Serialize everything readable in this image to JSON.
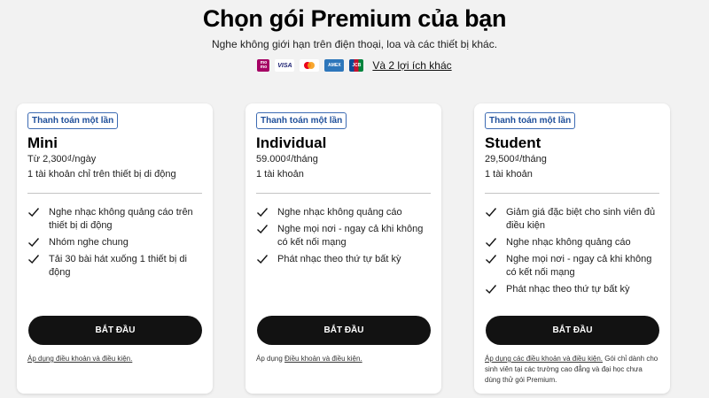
{
  "header": {
    "title": "Chọn gói Premium của bạn",
    "subtitle": "Nghe không giới hạn trên điện thoại, loa và các thiết bị khác.",
    "payment_methods": [
      {
        "icon": "momo-icon",
        "label": "mo mo"
      },
      {
        "icon": "visa-icon",
        "label": "VISA"
      },
      {
        "icon": "mastercard-icon",
        "label": ""
      },
      {
        "icon": "amex-icon",
        "label": "AMEX"
      },
      {
        "icon": "jcb-icon",
        "label": "JCB"
      }
    ],
    "more_benefits": "Và 2 lợi ích khác"
  },
  "plans": [
    {
      "badge": "Thanh toán một lần",
      "name": "Mini",
      "price": "Từ 2,300₫/ngày",
      "accounts": "1 tài khoản chỉ trên thiết bị di động",
      "features": [
        "Nghe nhạc không quảng cáo trên thiết bị di động",
        "Nhóm nghe chung",
        "Tải 30 bài hát xuống 1 thiết bị di động"
      ],
      "cta": "BẮT ĐẦU",
      "terms_prefix": "",
      "terms_link": "Áp dụng điều khoản và điều kiện.",
      "terms_suffix": ""
    },
    {
      "badge": "Thanh toán một lần",
      "name": "Individual",
      "price": "59.000₫/tháng",
      "accounts": "1 tài khoản",
      "features": [
        "Nghe nhạc không quảng cáo",
        "Nghe mọi nơi - ngay cả khi không có kết nối mạng",
        "Phát nhạc theo thứ tự bất kỳ"
      ],
      "cta": "BẮT ĐẦU",
      "terms_prefix": "Áp dụng ",
      "terms_link": "Điều khoản và điều kiện.",
      "terms_suffix": ""
    },
    {
      "badge": "Thanh toán một lần",
      "name": "Student",
      "price": "29,500₫/tháng",
      "accounts": "1 tài khoản",
      "features": [
        "Giảm giá đặc biệt cho sinh viên đủ điều kiện",
        "Nghe nhạc không quảng cáo",
        "Nghe mọi nơi - ngay cả khi không có kết nối mạng",
        "Phát nhạc theo thứ tự bất kỳ"
      ],
      "cta": "BẮT ĐẦU",
      "terms_prefix": "",
      "terms_link": "Áp dụng các điều khoản và điều kiện.",
      "terms_suffix": " Gói chỉ dành cho sinh viên tại các trường cao đẳng và đại học chưa dùng thử gói Premium."
    }
  ]
}
